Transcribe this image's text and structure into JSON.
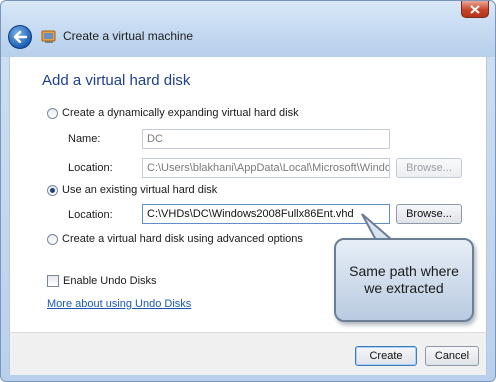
{
  "window": {
    "title": "Create a virtual machine"
  },
  "page": {
    "heading": "Add a virtual hard disk"
  },
  "options": {
    "dynamic": {
      "label": "Create a dynamically expanding virtual hard disk",
      "checked": false
    },
    "existing": {
      "label": "Use an existing virtual hard disk",
      "checked": true
    },
    "advanced": {
      "label": "Create a virtual hard disk using advanced options",
      "checked": false
    }
  },
  "dynamic_fields": {
    "name_label": "Name:",
    "name_value": "DC",
    "location_label": "Location:",
    "location_value": "C:\\Users\\blakhani\\AppData\\Local\\Microsoft\\Windo",
    "browse_label": "Browse..."
  },
  "existing_fields": {
    "location_label": "Location:",
    "location_value": "C:\\VHDs\\DC\\Windows2008Fullx86Ent.vhd",
    "browse_label": "Browse..."
  },
  "undo": {
    "label": "Enable Undo Disks",
    "checked": false,
    "link": "More about using Undo Disks"
  },
  "callout": {
    "line1": "Same path where",
    "line2": "we extracted"
  },
  "footer": {
    "create_label": "Create",
    "cancel_label": "Cancel"
  },
  "colors": {
    "heading": "#1f3f8f",
    "link": "#1a57b3",
    "close_button": "#c7462a",
    "back_button": "#1d5fb5"
  },
  "icons": {
    "back": "back-arrow-icon",
    "app": "virtual-machine-icon",
    "close": "close-icon"
  }
}
